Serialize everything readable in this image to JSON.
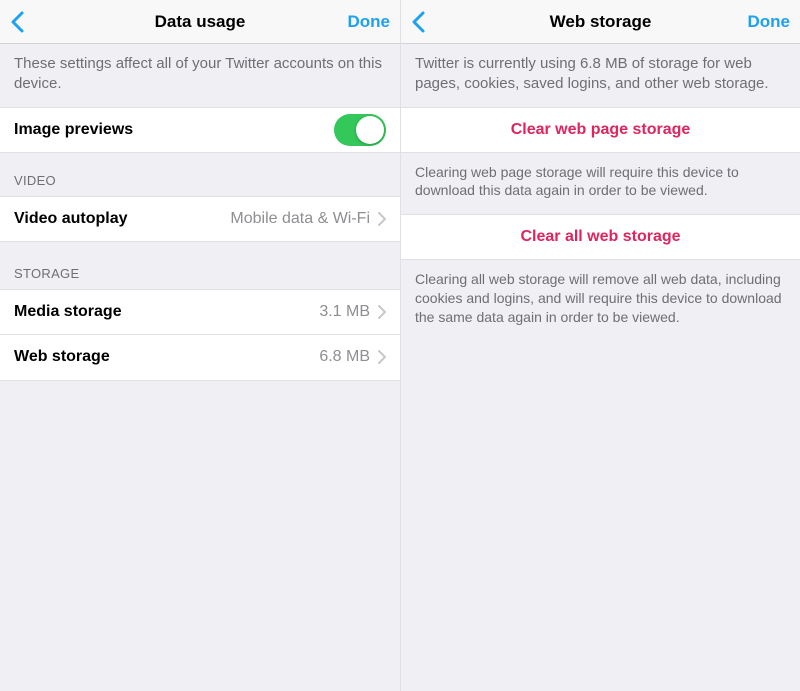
{
  "left": {
    "nav": {
      "title": "Data usage",
      "done": "Done"
    },
    "description": "These settings affect all of your Twitter accounts on this device.",
    "imagePreviews": {
      "label": "Image previews",
      "on": true
    },
    "videoHeader": "VIDEO",
    "videoAutoplay": {
      "label": "Video autoplay",
      "value": "Mobile data & Wi-Fi"
    },
    "storageHeader": "STORAGE",
    "mediaStorage": {
      "label": "Media storage",
      "value": "3.1 MB"
    },
    "webStorage": {
      "label": "Web storage",
      "value": "6.8 MB"
    }
  },
  "right": {
    "nav": {
      "title": "Web storage",
      "done": "Done"
    },
    "description": "Twitter is currently using 6.8 MB of storage for web pages, cookies, saved logins, and other web storage.",
    "clearPage": {
      "label": "Clear web page storage",
      "note": "Clearing web page storage will require this device to download this data again in order to be viewed."
    },
    "clearAll": {
      "label": "Clear all web storage",
      "note": "Clearing all web storage will remove all web data, including cookies and logins, and will require this device to download the same data again in order to be viewed."
    }
  }
}
